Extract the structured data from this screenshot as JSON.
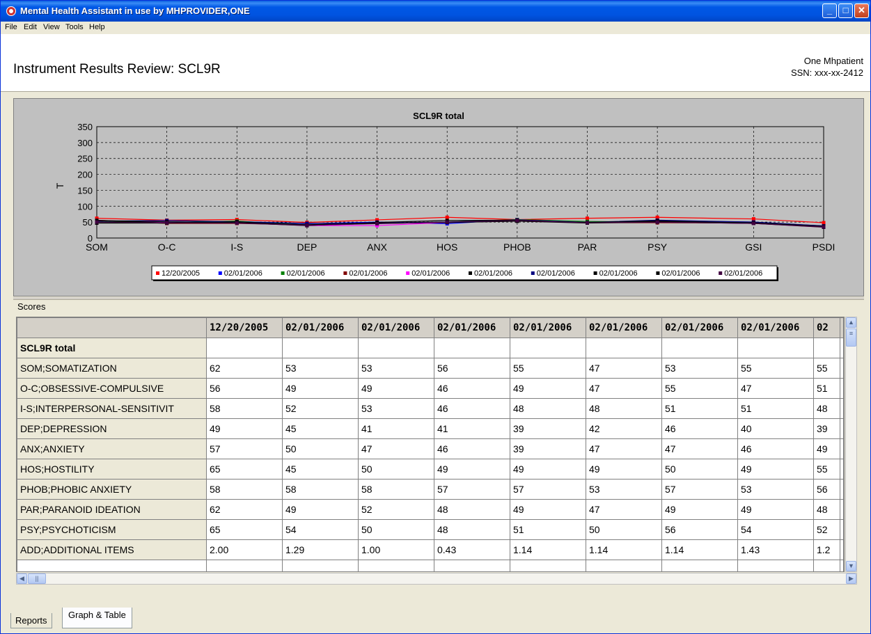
{
  "window": {
    "title": "Mental Health Assistant in use by MHPROVIDER,ONE",
    "buttons": {
      "minimize": "_",
      "maximize": "□",
      "close": "✕"
    }
  },
  "menu": [
    "File",
    "Edit",
    "View",
    "Tools",
    "Help"
  ],
  "header": {
    "title": "Instrument Results Review: SCL9R",
    "patient_name": "One Mhpatient",
    "ssn": "SSN: xxx-xx-2412"
  },
  "chart_data": {
    "type": "line",
    "title": "SCL9R total",
    "ylabel": "T",
    "xlabel": "",
    "categories": [
      "SOM",
      "O-C",
      "I-S",
      "DEP",
      "ANX",
      "HOS",
      "PHOB",
      "PAR",
      "PSY",
      "GSI",
      "PSDI"
    ],
    "yticks": [
      0,
      50,
      100,
      150,
      200,
      250,
      300,
      350
    ],
    "ylim": [
      0,
      350
    ],
    "grid": true,
    "legend_position": "bottom",
    "series": [
      {
        "name": "12/20/2005",
        "color": "#ff0000",
        "marker": "cross",
        "values": [
          62,
          56,
          58,
          49,
          57,
          65,
          58,
          62,
          65,
          60,
          48
        ]
      },
      {
        "name": "02/01/2006",
        "color": "#0000ff",
        "marker": "dash",
        "values": [
          53,
          49,
          52,
          45,
          50,
          45,
          58,
          49,
          54,
          50,
          38
        ]
      },
      {
        "name": "02/01/2006",
        "color": "#008000",
        "marker": "cross",
        "values": [
          53,
          49,
          53,
          41,
          47,
          50,
          58,
          52,
          50,
          48,
          36
        ]
      },
      {
        "name": "02/01/2006",
        "color": "#800000",
        "marker": "star",
        "values": [
          56,
          46,
          46,
          41,
          46,
          49,
          57,
          48,
          48,
          47,
          36
        ]
      },
      {
        "name": "02/01/2006",
        "color": "#ff00ff",
        "marker": "cross",
        "values": [
          55,
          49,
          48,
          39,
          39,
          49,
          57,
          49,
          51,
          46,
          34
        ]
      },
      {
        "name": "02/01/2006",
        "color": "#000000",
        "marker": "diamond",
        "values": [
          47,
          47,
          48,
          42,
          47,
          49,
          53,
          47,
          50,
          46,
          34
        ]
      },
      {
        "name": "02/01/2006",
        "color": "#000080",
        "marker": "square",
        "values": [
          53,
          55,
          51,
          46,
          47,
          50,
          57,
          49,
          56,
          50,
          38
        ]
      },
      {
        "name": "02/01/2006",
        "color": "#000000",
        "marker": "triangle",
        "values": [
          55,
          47,
          51,
          40,
          46,
          49,
          53,
          49,
          54,
          47,
          35
        ]
      },
      {
        "name": "02/01/2006",
        "color": "#000000",
        "marker": "down-triangle",
        "values": [
          55,
          51,
          48,
          39,
          49,
          55,
          56,
          48,
          52,
          48,
          37
        ]
      },
      {
        "name": "02/01/2006",
        "color": "#400040",
        "marker": "diamond",
        "values": [
          50,
          48,
          47,
          40,
          45,
          50,
          55,
          48,
          50,
          46,
          35
        ]
      }
    ]
  },
  "scores": {
    "label": "Scores",
    "columns": [
      "12/20/2005",
      "02/01/2006",
      "02/01/2006",
      "02/01/2006",
      "02/01/2006",
      "02/01/2006",
      "02/01/2006",
      "02/01/2006",
      "02"
    ],
    "section": "SCL9R total",
    "rows": [
      {
        "label": "SOM;SOMATIZATION",
        "values": [
          "62",
          "53",
          "53",
          "56",
          "55",
          "47",
          "53",
          "55",
          "55"
        ]
      },
      {
        "label": "O-C;OBSESSIVE-COMPULSIVE",
        "values": [
          "56",
          "49",
          "49",
          "46",
          "49",
          "47",
          "55",
          "47",
          "51"
        ]
      },
      {
        "label": "I-S;INTERPERSONAL-SENSITIVIT",
        "values": [
          "58",
          "52",
          "53",
          "46",
          "48",
          "48",
          "51",
          "51",
          "48"
        ]
      },
      {
        "label": "DEP;DEPRESSION",
        "values": [
          "49",
          "45",
          "41",
          "41",
          "39",
          "42",
          "46",
          "40",
          "39"
        ]
      },
      {
        "label": "ANX;ANXIETY",
        "values": [
          "57",
          "50",
          "47",
          "46",
          "39",
          "47",
          "47",
          "46",
          "49"
        ]
      },
      {
        "label": "HOS;HOSTILITY",
        "values": [
          "65",
          "45",
          "50",
          "49",
          "49",
          "49",
          "50",
          "49",
          "55"
        ]
      },
      {
        "label": "PHOB;PHOBIC ANXIETY",
        "values": [
          "58",
          "58",
          "58",
          "57",
          "57",
          "53",
          "57",
          "53",
          "56"
        ]
      },
      {
        "label": "PAR;PARANOID IDEATION",
        "values": [
          "62",
          "49",
          "52",
          "48",
          "49",
          "47",
          "49",
          "49",
          "48"
        ]
      },
      {
        "label": "PSY;PSYCHOTICISM",
        "values": [
          "65",
          "54",
          "50",
          "48",
          "51",
          "50",
          "56",
          "54",
          "52"
        ]
      },
      {
        "label": "ADD;ADDITIONAL ITEMS",
        "values": [
          "2.00",
          "1.29",
          "1.00",
          "0.43",
          "1.14",
          "1.14",
          "1.14",
          "1.43",
          "1.2"
        ]
      }
    ]
  },
  "tabs": [
    {
      "label": "Reports",
      "active": false
    },
    {
      "label": "Graph & Table",
      "active": true
    }
  ]
}
